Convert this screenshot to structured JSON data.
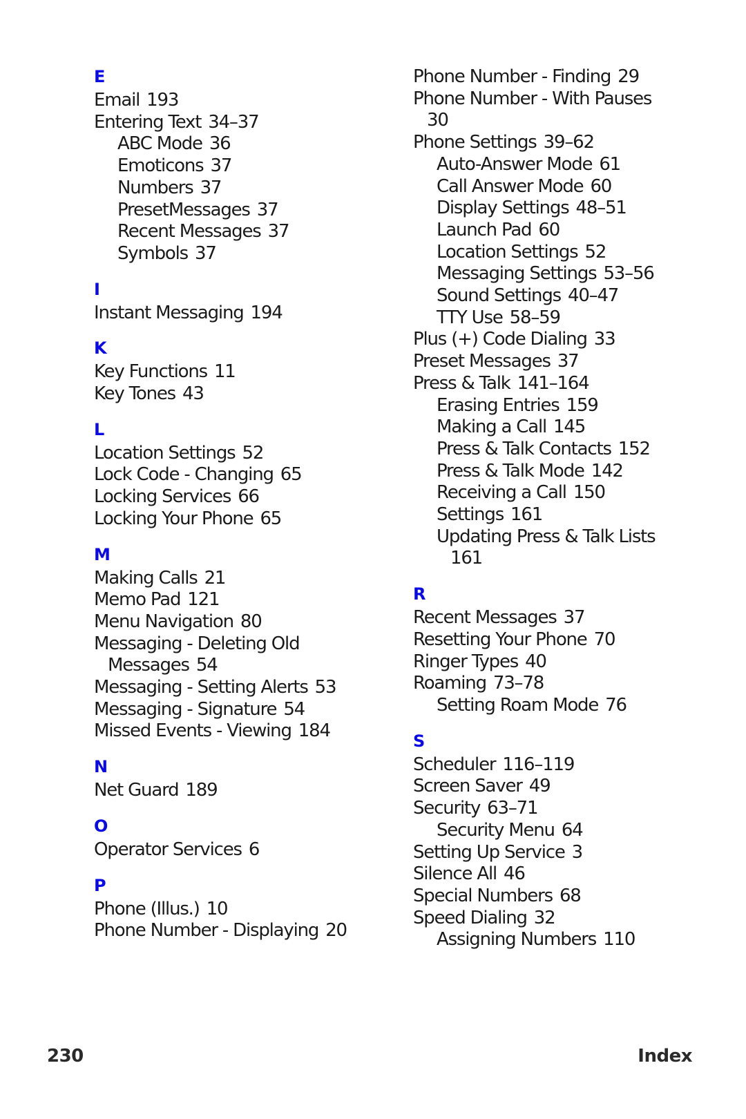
{
  "left_column": [
    {
      "letter": "E",
      "entries": [
        {
          "text": "Email",
          "page": "193",
          "level": 0
        },
        {
          "text": "Entering Text",
          "page": "34–37",
          "level": 0
        },
        {
          "text": "ABC Mode",
          "page": "36",
          "level": 1
        },
        {
          "text": "Emoticons",
          "page": "37",
          "level": 1
        },
        {
          "text": "Numbers",
          "page": "37",
          "level": 1
        },
        {
          "text": "PresetMessages",
          "page": "37",
          "level": 1
        },
        {
          "text": "Recent Messages",
          "page": "37",
          "level": 1
        },
        {
          "text": "Symbols",
          "page": "37",
          "level": 1
        }
      ]
    },
    {
      "letter": "I",
      "entries": [
        {
          "text": "Instant Messaging",
          "page": "194",
          "level": 0
        }
      ]
    },
    {
      "letter": "K",
      "entries": [
        {
          "text": "Key Functions",
          "page": "11",
          "level": 0
        },
        {
          "text": "Key Tones",
          "page": "43",
          "level": 0
        }
      ]
    },
    {
      "letter": "L",
      "entries": [
        {
          "text": "Location Settings",
          "page": "52",
          "level": 0
        },
        {
          "text": "Lock Code - Changing",
          "page": "65",
          "level": 0
        },
        {
          "text": "Locking Services",
          "page": "66",
          "level": 0
        },
        {
          "text": "Locking Your Phone",
          "page": "65",
          "level": 0
        }
      ]
    },
    {
      "letter": "M",
      "entries": [
        {
          "text": "Making Calls",
          "page": "21",
          "level": 0
        },
        {
          "text": "Memo Pad",
          "page": "121",
          "level": 0
        },
        {
          "text": "Menu Navigation",
          "page": "80",
          "level": 0
        },
        {
          "text": "Messaging - Deleting Old",
          "continuation": "Messages",
          "page": "54",
          "level": 0
        },
        {
          "text": "Messaging - Setting Alerts",
          "page": "53",
          "level": 0
        },
        {
          "text": "Messaging - Signature",
          "page": "54",
          "level": 0
        },
        {
          "text": "Missed Events - Viewing",
          "page": "184",
          "level": 0
        }
      ]
    },
    {
      "letter": "N",
      "entries": [
        {
          "text": "Net Guard",
          "page": "189",
          "level": 0
        }
      ]
    },
    {
      "letter": "O",
      "entries": [
        {
          "text": "Operator Services",
          "page": "6",
          "level": 0
        }
      ]
    },
    {
      "letter": "P",
      "entries": [
        {
          "text": "Phone (Illus.)",
          "page": "10",
          "level": 0
        },
        {
          "text": "Phone Number - Displaying",
          "page": "20",
          "level": 0
        }
      ]
    }
  ],
  "right_column": [
    {
      "letter": "",
      "entries": [
        {
          "text": "Phone Number - Finding",
          "page": "29",
          "level": 0
        },
        {
          "text": "Phone Number - With Pauses",
          "continuation": "",
          "page": "30",
          "level": 0
        },
        {
          "text": "Phone Settings",
          "page": "39–62",
          "level": 0
        },
        {
          "text": "Auto-Answer Mode",
          "page": "61",
          "level": 1
        },
        {
          "text": "Call Answer Mode",
          "page": "60",
          "level": 1
        },
        {
          "text": "Display Settings",
          "page": "48–51",
          "level": 1
        },
        {
          "text": "Launch Pad",
          "page": "60",
          "level": 1
        },
        {
          "text": "Location Settings",
          "page": "52",
          "level": 1
        },
        {
          "text": "Messaging Settings",
          "page": "53–56",
          "level": 1
        },
        {
          "text": "Sound Settings",
          "page": "40–47",
          "level": 1
        },
        {
          "text": "TTY Use",
          "page": "58–59",
          "level": 1
        },
        {
          "text": "Plus (+) Code Dialing",
          "page": "33",
          "level": 0
        },
        {
          "text": "Preset Messages",
          "page": "37",
          "level": 0
        },
        {
          "text": "Press & Talk",
          "page": "141–164",
          "level": 0
        },
        {
          "text": "Erasing Entries",
          "page": "159",
          "level": 1
        },
        {
          "text": "Making a Call",
          "page": "145",
          "level": 1
        },
        {
          "text": "Press & Talk Contacts",
          "page": "152",
          "level": 1
        },
        {
          "text": "Press & Talk Mode",
          "page": "142",
          "level": 1
        },
        {
          "text": "Receiving a Call",
          "page": "150",
          "level": 1
        },
        {
          "text": "Settings",
          "page": "161",
          "level": 1
        },
        {
          "text": "Updating Press & Talk Lists",
          "continuation": "",
          "page": "161",
          "level": 1
        }
      ]
    },
    {
      "letter": "R",
      "entries": [
        {
          "text": "Recent Messages",
          "page": "37",
          "level": 0
        },
        {
          "text": "Resetting Your Phone",
          "page": "70",
          "level": 0
        },
        {
          "text": "Ringer Types",
          "page": "40",
          "level": 0
        },
        {
          "text": "Roaming",
          "page": "73–78",
          "level": 0
        },
        {
          "text": "Setting Roam Mode",
          "page": "76",
          "level": 1
        }
      ]
    },
    {
      "letter": "S",
      "entries": [
        {
          "text": "Scheduler",
          "page": "116–119",
          "level": 0
        },
        {
          "text": "Screen Saver",
          "page": "49",
          "level": 0
        },
        {
          "text": "Security",
          "page": "63–71",
          "level": 0
        },
        {
          "text": "Security Menu",
          "page": "64",
          "level": 1
        },
        {
          "text": "Setting Up Service",
          "page": "3",
          "level": 0
        },
        {
          "text": "Silence All",
          "page": "46",
          "level": 0
        },
        {
          "text": "Special Numbers",
          "page": "68",
          "level": 0
        },
        {
          "text": "Speed Dialing",
          "page": "32",
          "level": 0
        },
        {
          "text": "Assigning Numbers",
          "page": "110",
          "level": 1
        }
      ]
    }
  ],
  "footer": {
    "page_number": "230",
    "section_title": "Index"
  },
  "colors": {
    "letter_heading": "#0a0ae6",
    "text": "#1a1a1a"
  }
}
